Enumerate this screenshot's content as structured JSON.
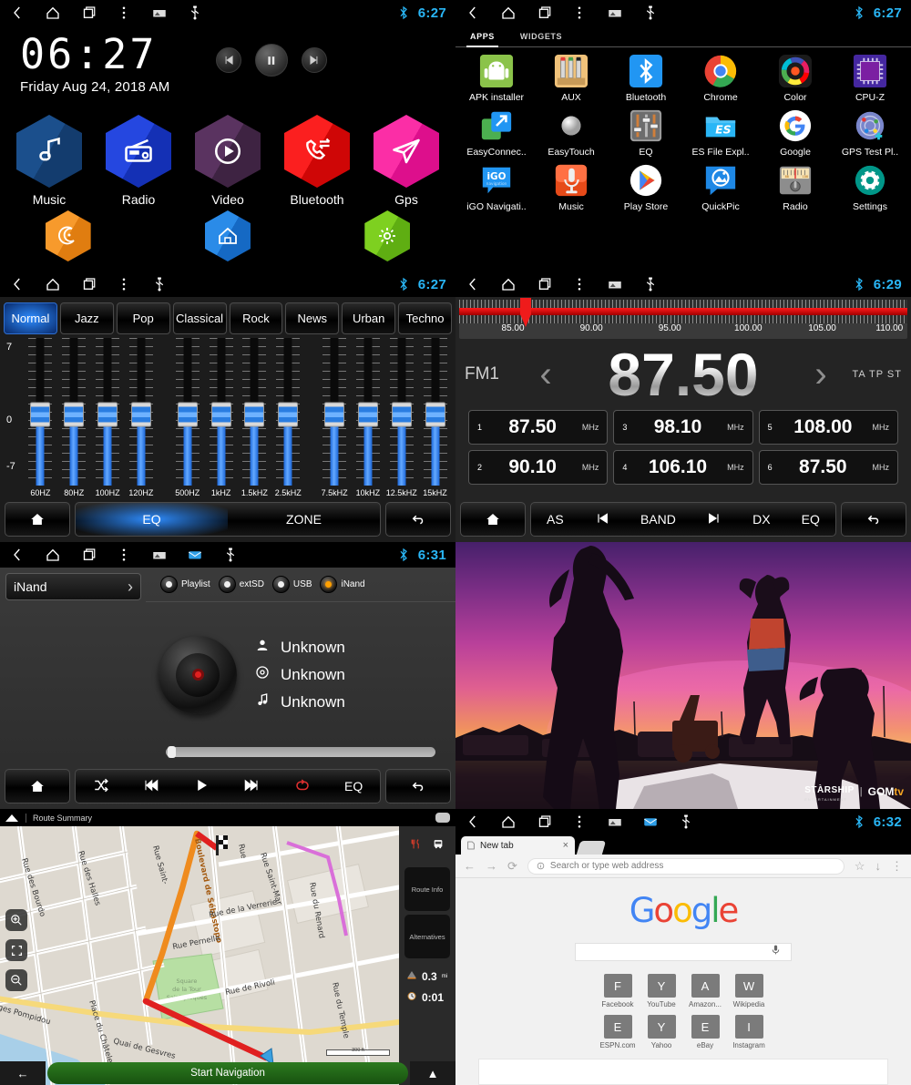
{
  "statusbar": {
    "icons": [
      "back-icon",
      "home-icon",
      "recents-icon",
      "overflow-icon",
      "screenshot-icon",
      "usb-icon"
    ],
    "bluetooth": "bluetooth-icon",
    "times": {
      "home": "6:27",
      "apps": "6:27",
      "eq": "6:27",
      "radio": "6:29",
      "music": "6:31",
      "chrome": "6:32"
    }
  },
  "home": {
    "clock_time": "06:27",
    "clock_date": "Friday Aug 24, 2018 AM",
    "media_controls": [
      "prev-button",
      "pause-button",
      "next-button"
    ],
    "tiles": [
      {
        "label": "Music",
        "icon": "music-note-icon",
        "color": "#17477f"
      },
      {
        "label": "Radio",
        "icon": "radio-icon",
        "color": "#1d3fd4"
      },
      {
        "label": "Video",
        "icon": "play-circle-icon",
        "color": "#4b2a4e"
      },
      {
        "label": "Bluetooth",
        "icon": "phone-swap-icon",
        "color": "#ee1010"
      },
      {
        "label": "Gps",
        "icon": "paper-plane-icon",
        "color": "#ef1e9c"
      }
    ],
    "small_tiles": [
      {
        "label": "",
        "icon": "moon-icon",
        "color": "#f18a1b"
      },
      {
        "label": "",
        "icon": "house-icon",
        "color": "#1b77d4"
      },
      {
        "label": "",
        "icon": "gear-icon",
        "color": "#6ec41e"
      }
    ]
  },
  "apps": {
    "tabs": [
      "APPS",
      "WIDGETS"
    ],
    "active_tab": "APPS",
    "items": [
      {
        "label": "APK installer",
        "icon": "android-icon",
        "color": "#8bc34a"
      },
      {
        "label": "AUX",
        "icon": "aux-plugs-icon",
        "color": "#f0c27a"
      },
      {
        "label": "Bluetooth",
        "icon": "bluetooth-icon",
        "color": "#2196f3"
      },
      {
        "label": "Chrome",
        "icon": "chrome-icon",
        "color": "#ffffff"
      },
      {
        "label": "Color",
        "icon": "color-wheel-icon",
        "color": "#222222"
      },
      {
        "label": "CPU-Z",
        "icon": "cpu-chip-icon",
        "color": "#4527a0"
      },
      {
        "label": "EasyConnec..",
        "icon": "easyconnect-icon",
        "color": "#111111"
      },
      {
        "label": "EasyTouch",
        "icon": "easytouch-icon",
        "color": "#111111"
      },
      {
        "label": "EQ",
        "icon": "equalizer-icon",
        "color": "#9e9e9e"
      },
      {
        "label": "ES File Expl..",
        "icon": "es-folder-icon",
        "color": "#29b6f6"
      },
      {
        "label": "Google",
        "icon": "google-g-icon",
        "color": "#ffffff"
      },
      {
        "label": "GPS Test Pl..",
        "icon": "gps-test-icon",
        "color": "#5c6bc0"
      },
      {
        "label": "iGO Navigati..",
        "icon": "igo-icon",
        "color": "#2196f3"
      },
      {
        "label": "Music",
        "icon": "mic-music-icon",
        "color": "#e64a19"
      },
      {
        "label": "Play Store",
        "icon": "play-store-icon",
        "color": "#ffffff"
      },
      {
        "label": "QuickPic",
        "icon": "quickpic-icon",
        "color": "#1e88e5"
      },
      {
        "label": "Radio",
        "icon": "radio-tuner-icon",
        "color": "#9e9e9e"
      },
      {
        "label": "Settings",
        "icon": "gear-icon",
        "color": "#009688"
      }
    ]
  },
  "eq": {
    "presets": [
      "Normal",
      "Jazz",
      "Pop",
      "Classical",
      "Rock",
      "News",
      "Urban",
      "Techno"
    ],
    "active_preset": "Normal",
    "scale": {
      "max": "7",
      "mid": "0",
      "min": "-7"
    },
    "bands_group_a": [
      "60HZ",
      "80HZ",
      "100HZ",
      "120HZ"
    ],
    "bands_group_b": [
      "500HZ",
      "1kHZ",
      "1.5kHZ",
      "2.5kHZ"
    ],
    "bands_group_c": [
      "7.5kHZ",
      "10kHZ",
      "12.5kHZ",
      "15kHZ"
    ],
    "toggle": {
      "eq": "EQ",
      "zone": "ZONE",
      "active": "EQ"
    },
    "home_button": "home-icon",
    "back_button": "back-arrow-icon"
  },
  "radio": {
    "dial_ticks": [
      "85.00",
      "90.00",
      "95.00",
      "100.00",
      "105.00",
      "110.00"
    ],
    "dial_range": [
      83.5,
      111.5
    ],
    "needle_value": 87.5,
    "band": "FM1",
    "frequency": "87.50",
    "indicators": "TA TP ST",
    "presets": [
      {
        "n": "1",
        "value": "87.50",
        "unit": "MHz"
      },
      {
        "n": "3",
        "value": "98.10",
        "unit": "MHz"
      },
      {
        "n": "5",
        "value": "108.00",
        "unit": "MHz"
      },
      {
        "n": "2",
        "value": "90.10",
        "unit": "MHz"
      },
      {
        "n": "4",
        "value": "106.10",
        "unit": "MHz"
      },
      {
        "n": "6",
        "value": "87.50",
        "unit": "MHz"
      }
    ],
    "toolbar": [
      "AS",
      "prev-icon",
      "BAND",
      "next-icon",
      "DX",
      "EQ"
    ],
    "home_button": "home-icon",
    "back_button": "back-arrow-icon"
  },
  "music": {
    "source_selector": "iNand",
    "sources": [
      {
        "label": "Playlist",
        "selected": false
      },
      {
        "label": "extSD",
        "selected": false
      },
      {
        "label": "USB",
        "selected": false
      },
      {
        "label": "iNand",
        "selected": true
      }
    ],
    "meta": [
      {
        "icon": "artist-icon",
        "value": "Unknown"
      },
      {
        "icon": "album-icon",
        "value": "Unknown"
      },
      {
        "icon": "track-icon",
        "value": "Unknown"
      }
    ],
    "progress_percent": 1,
    "toolbar": [
      "shuffle-icon",
      "previous-icon",
      "play-icon",
      "next-icon",
      "repeat-icon",
      "EQ"
    ],
    "eq_label": "EQ",
    "home_button": "home-icon",
    "back_button": "back-arrow-icon"
  },
  "video": {
    "watermark_brand": "STÀRSHIP",
    "watermark_sub": "ENTERTAINMENT",
    "watermark_divider": "|",
    "watermark_partner": "GOM",
    "watermark_partner_suffix": "tv",
    "scene": "sunset silhouette of dancers on a car"
  },
  "map": {
    "title": "Route Summary",
    "up_icon": "up-arrow-icon",
    "speech_icon": "speech-bubble-icon",
    "zoom_in": "zoom-in-icon",
    "zoom_out": "zoom-out-icon",
    "recenter": "recenter-icon",
    "side_icons": [
      "restaurant-icon",
      "bus-icon"
    ],
    "side_buttons": [
      "Route Info",
      "Alternatives"
    ],
    "distance": {
      "value": "0.3",
      "unit": "mi",
      "icon": "distance-icon"
    },
    "duration": {
      "value": "0:01",
      "icon": "clock-icon"
    },
    "start_button": "Start Navigation",
    "back_icon": "left-arrow-icon",
    "expand_icon": "chevron-up-icon",
    "scale_label": "300 ft",
    "streets": [
      "Rue des Bourdonnais",
      "Rue des Halles",
      "Rue Saint-",
      "Boulevard de Sébastopol",
      "Rue",
      "Rue Saint-Mar",
      "Rue de la Verrerie",
      "Rue Pernelle",
      "Rue du Renard",
      "Rue de Rivoli",
      "Rue du Temple",
      "Square de la Tour Saint-Jacques",
      "Place du Châtelet",
      "Quai de Gesvres",
      "rges Pompidou"
    ]
  },
  "chrome": {
    "tab_title": "New tab",
    "tab_close": "close-icon",
    "new_tab": "new-tab-icon",
    "nav": {
      "back": "back-arrow-icon",
      "forward": "forward-arrow-icon",
      "reload": "reload-icon"
    },
    "omnibox_placeholder": "Search or type web address",
    "omnibox_info": "info-icon",
    "star": "bookmark-star-icon",
    "download": "download-icon",
    "menu": "overflow-menu-icon",
    "logo": "Google",
    "logo_letters": [
      {
        "ch": "G",
        "color": "#4285f4"
      },
      {
        "ch": "o",
        "color": "#ea4335"
      },
      {
        "ch": "o",
        "color": "#fbbc05"
      },
      {
        "ch": "g",
        "color": "#4285f4"
      },
      {
        "ch": "l",
        "color": "#34a853"
      },
      {
        "ch": "e",
        "color": "#ea4335"
      }
    ],
    "search_value": "",
    "mic_icon": "microphone-icon",
    "tiles": [
      {
        "letter": "F",
        "label": "Facebook"
      },
      {
        "letter": "Y",
        "label": "YouTube"
      },
      {
        "letter": "A",
        "label": "Amazon..."
      },
      {
        "letter": "W",
        "label": "Wikipedia"
      },
      {
        "letter": "E",
        "label": "ESPN.com"
      },
      {
        "letter": "Y",
        "label": "Yahoo"
      },
      {
        "letter": "E",
        "label": "eBay"
      },
      {
        "letter": "I",
        "label": "Instagram"
      }
    ]
  }
}
